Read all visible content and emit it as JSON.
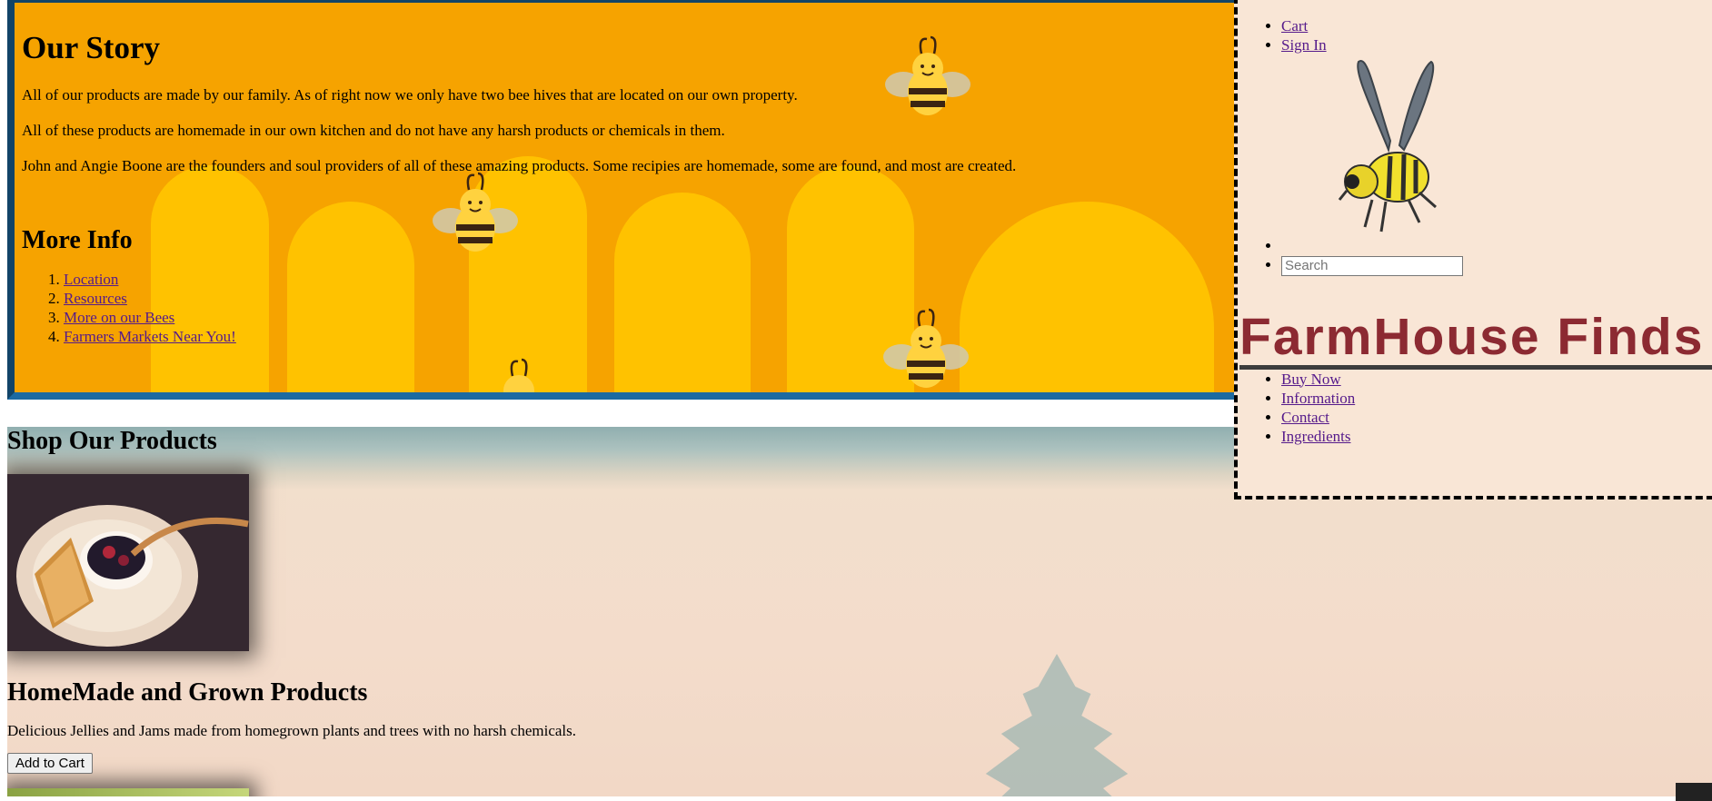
{
  "story": {
    "title": "Our Story",
    "paragraphs": [
      "All of our products are made by our family. As of right now we only have two bee hives that are located on our own property.",
      "All of these products are homemade in our own kitchen and do not have any harsh products or chemicals in them.",
      "John and Angie Boone are the founders and soul providers of all of these amazing products. Some recipies are homemade, some are found, and most are created."
    ],
    "more_info_title": "More Info",
    "links": [
      "Location",
      "Resources",
      "More on our Bees",
      "Farmers Markets Near You!"
    ]
  },
  "shop": {
    "title": "Shop Our Products",
    "product": {
      "title": "HomeMade and Grown Products",
      "description": "Delicious Jellies and Jams made from homegrown plants and trees with no harsh chemicals.",
      "button_label": "Add to Cart"
    }
  },
  "header": {
    "top_links": [
      "Cart",
      "Sign In"
    ],
    "search_placeholder": "Search",
    "brand": "FarmHouse Finds",
    "nav": [
      "Buy Now",
      "Information",
      "Contact",
      "Ingredients"
    ]
  },
  "colors": {
    "story_bg": "#f6a300",
    "honey_drip": "#ffc200",
    "story_border": "#124468",
    "header_bg": "#f9e6d6",
    "brand": "#8c2a32"
  },
  "icons": [
    "bee-icon",
    "bee-logo-icon"
  ]
}
